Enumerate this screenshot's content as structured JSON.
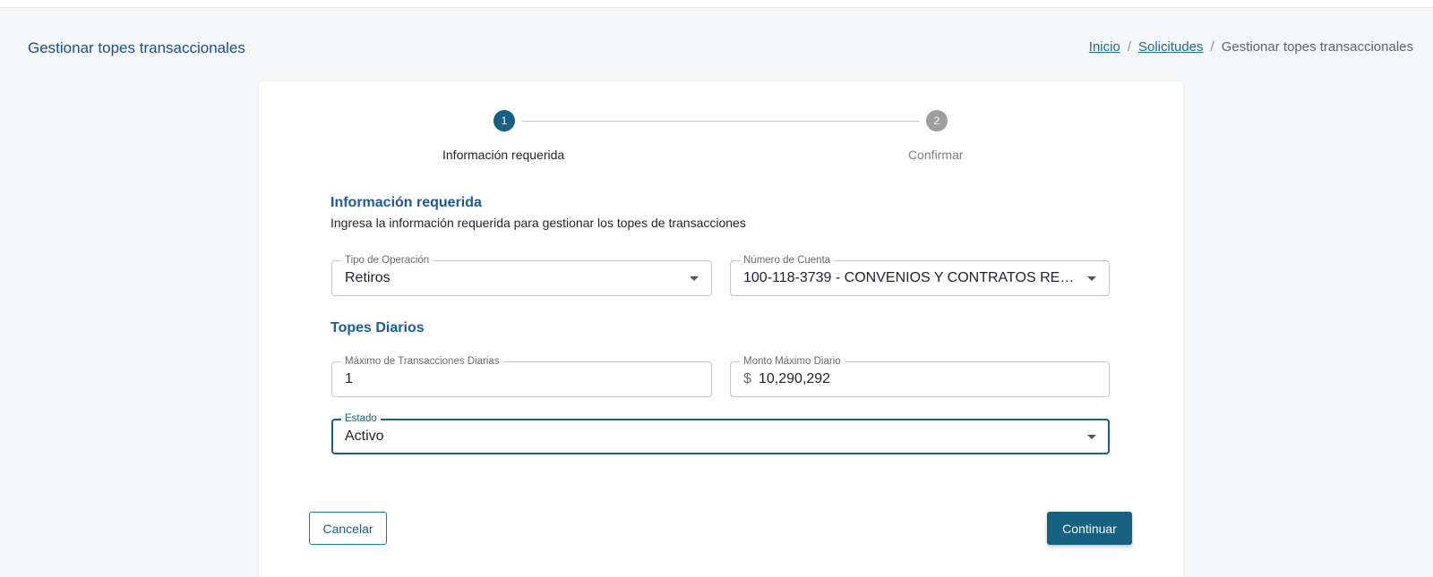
{
  "header": {
    "title": "Gestionar topes transaccionales",
    "breadcrumb": {
      "home": "Inicio",
      "sep1": "/",
      "requests": "Solicitudes",
      "sep2": "/",
      "current": "Gestionar topes transaccionales"
    }
  },
  "stepper": {
    "steps": [
      {
        "number": "1",
        "label": "Información requerida",
        "state": "active"
      },
      {
        "number": "2",
        "label": "Confirmar",
        "state": "inactive"
      }
    ]
  },
  "form": {
    "section_title": "Información requerida",
    "section_desc": "Ingresa la información requerida para gestionar los topes de transacciones",
    "operation_type": {
      "label": "Tipo de Operación",
      "value": "Retiros"
    },
    "account_number": {
      "label": "Número de Cuenta",
      "value": "100-118-3739 - CONVENIOS Y CONTRATOS REC…"
    },
    "daily_limits_title": "Topes Diarios",
    "max_daily_transactions": {
      "label": "Máximo de Transacciones Diarias",
      "value": "1"
    },
    "max_daily_amount": {
      "label": "Monto Máximo Diario",
      "prefix": "$",
      "value": "10,290,292"
    },
    "status": {
      "label": "Estado",
      "value": "Activo"
    }
  },
  "actions": {
    "cancel_label": "Cancelar",
    "continue_label": "Continuar"
  },
  "colors": {
    "primary": "#17607f",
    "title_blue": "#1d5a9a",
    "step_inactive": "#9e9e9e",
    "background": "#f6f7f9"
  }
}
